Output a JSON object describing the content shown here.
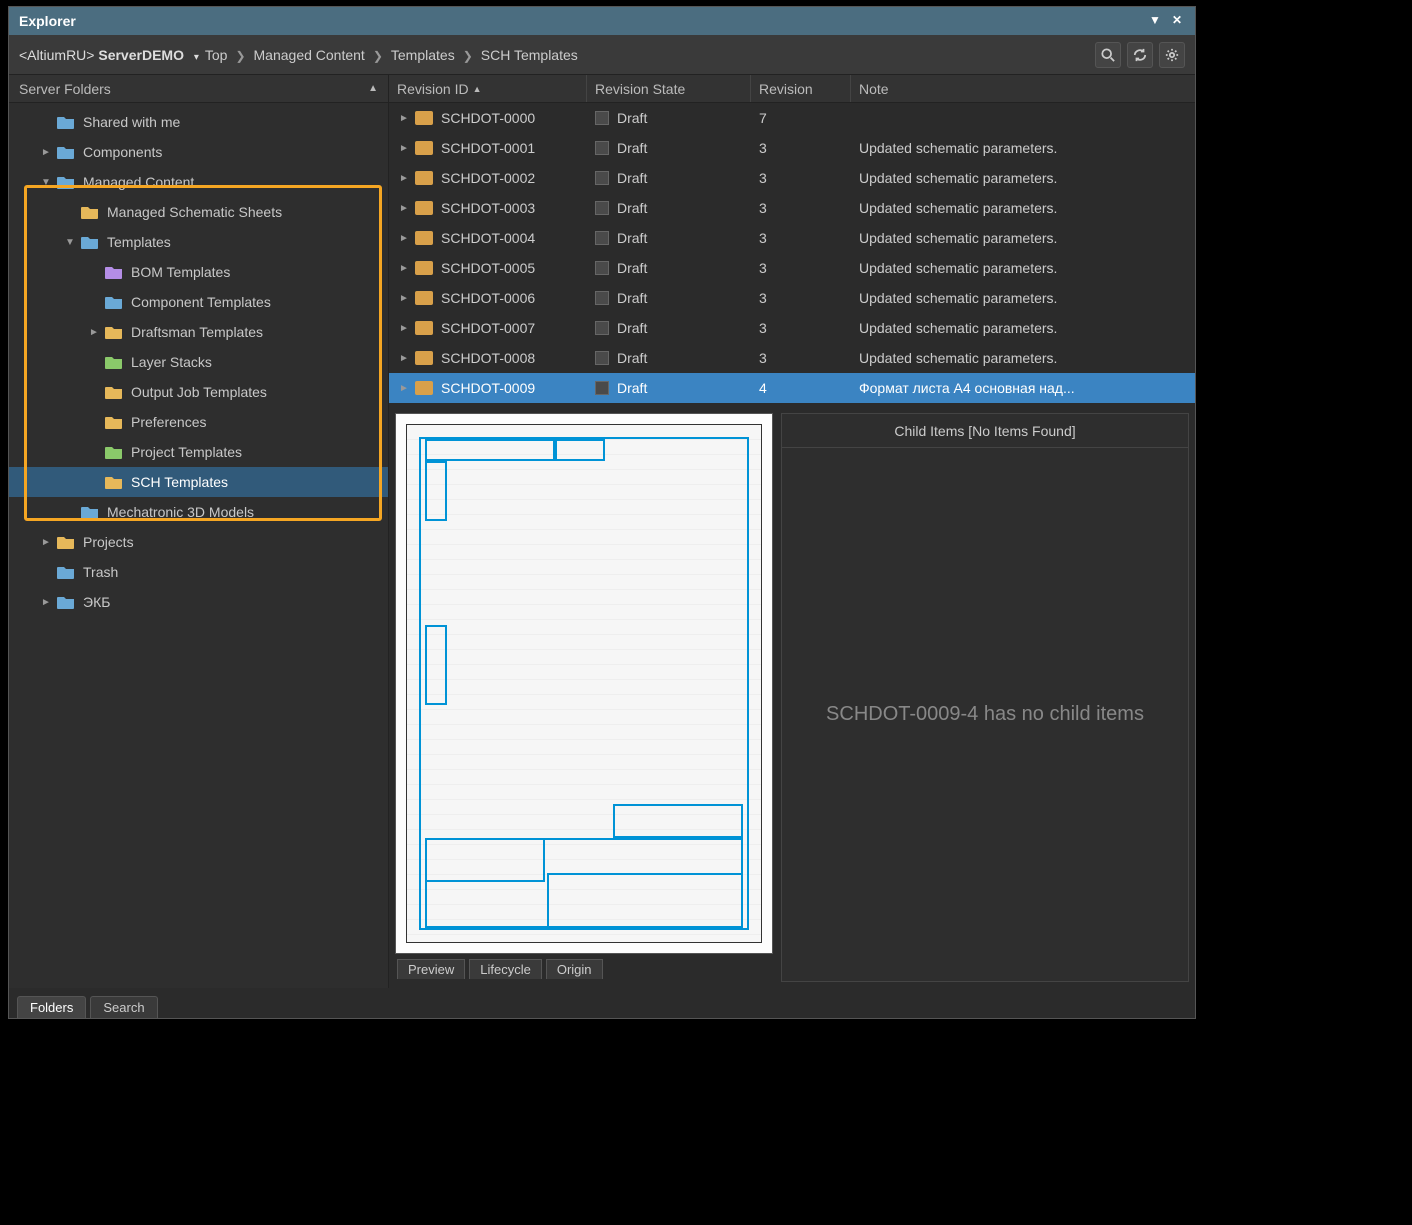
{
  "title": "Explorer",
  "toolbar": {
    "server_prefix": "<AltiumRU>",
    "server_name": "ServerDEMO",
    "breadcrumbs": [
      "Top",
      "Managed Content",
      "Templates",
      "SCH Templates"
    ]
  },
  "sidebar": {
    "header": "Server Folders",
    "items": [
      {
        "label": "Shared with me",
        "depth": 1,
        "expander": ""
      },
      {
        "label": "Components",
        "depth": 1,
        "expander": "►"
      },
      {
        "label": "Managed Content",
        "depth": 1,
        "expander": "▼"
      },
      {
        "label": "Managed Schematic Sheets",
        "depth": 2,
        "expander": ""
      },
      {
        "label": "Templates",
        "depth": 2,
        "expander": "▼"
      },
      {
        "label": "BOM Templates",
        "depth": 3,
        "expander": ""
      },
      {
        "label": "Component Templates",
        "depth": 3,
        "expander": ""
      },
      {
        "label": "Draftsman Templates",
        "depth": 3,
        "expander": "►"
      },
      {
        "label": "Layer Stacks",
        "depth": 3,
        "expander": ""
      },
      {
        "label": "Output Job Templates",
        "depth": 3,
        "expander": ""
      },
      {
        "label": "Preferences",
        "depth": 3,
        "expander": ""
      },
      {
        "label": "Project Templates",
        "depth": 3,
        "expander": ""
      },
      {
        "label": "SCH Templates",
        "depth": 3,
        "expander": "",
        "selected": true
      },
      {
        "label": "Mechatronic 3D Models",
        "depth": 2,
        "expander": ""
      },
      {
        "label": "Projects",
        "depth": 1,
        "expander": "►"
      },
      {
        "label": "Trash",
        "depth": 1,
        "expander": ""
      },
      {
        "label": "ЭКБ",
        "depth": 1,
        "expander": "►"
      }
    ]
  },
  "grid": {
    "cols": {
      "id": "Revision ID",
      "state": "Revision State",
      "rev": "Revision",
      "note": "Note"
    },
    "rows": [
      {
        "id": "SCHDOT-0000",
        "state": "Draft",
        "rev": "7",
        "note": ""
      },
      {
        "id": "SCHDOT-0001",
        "state": "Draft",
        "rev": "3",
        "note": "Updated schematic parameters."
      },
      {
        "id": "SCHDOT-0002",
        "state": "Draft",
        "rev": "3",
        "note": "Updated schematic parameters."
      },
      {
        "id": "SCHDOT-0003",
        "state": "Draft",
        "rev": "3",
        "note": "Updated schematic parameters."
      },
      {
        "id": "SCHDOT-0004",
        "state": "Draft",
        "rev": "3",
        "note": "Updated schematic parameters."
      },
      {
        "id": "SCHDOT-0005",
        "state": "Draft",
        "rev": "3",
        "note": "Updated schematic parameters."
      },
      {
        "id": "SCHDOT-0006",
        "state": "Draft",
        "rev": "3",
        "note": "Updated schematic parameters."
      },
      {
        "id": "SCHDOT-0007",
        "state": "Draft",
        "rev": "3",
        "note": "Updated schematic parameters."
      },
      {
        "id": "SCHDOT-0008",
        "state": "Draft",
        "rev": "3",
        "note": "Updated schematic parameters."
      },
      {
        "id": "SCHDOT-0009",
        "state": "Draft",
        "rev": "4",
        "note": "Формат листа А4 основная над...",
        "selected": true
      }
    ]
  },
  "preview_tabs": [
    "Preview",
    "Lifecycle",
    "Origin"
  ],
  "child": {
    "header": "Child Items [No Items Found]",
    "body": "SCHDOT-0009-4 has no child items"
  },
  "bottom_tabs": [
    "Folders",
    "Search"
  ]
}
